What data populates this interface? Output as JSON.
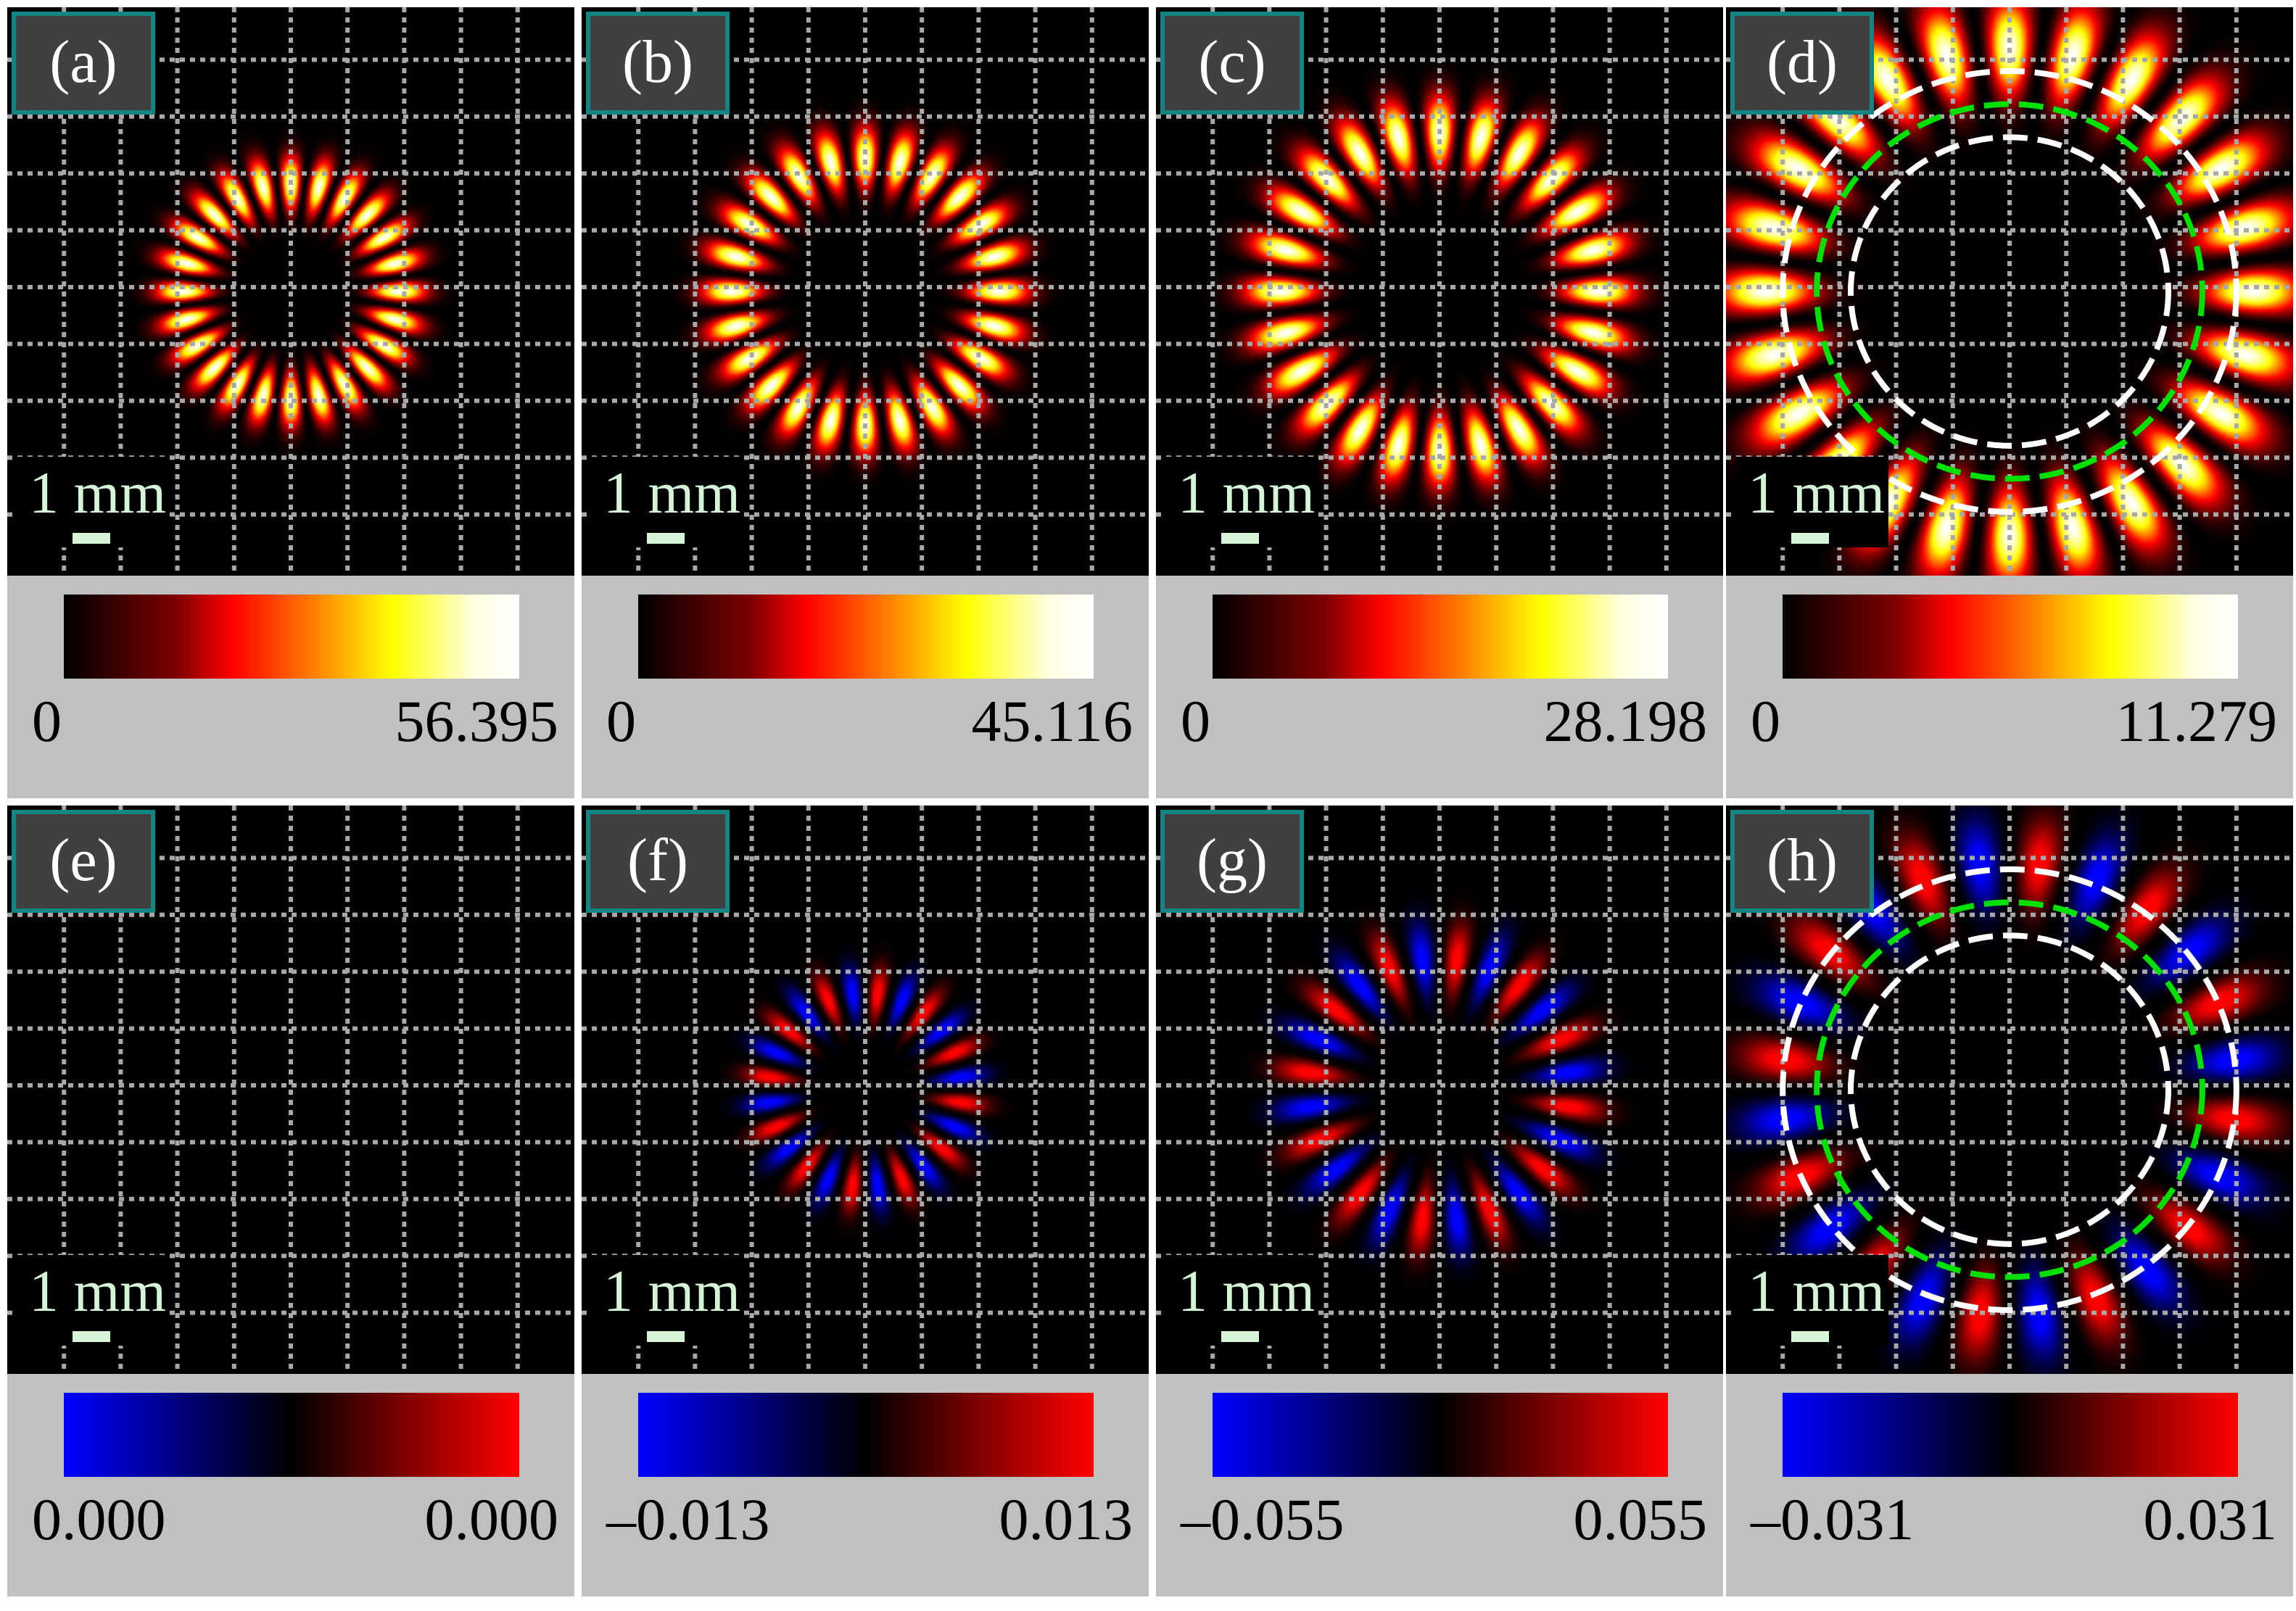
{
  "figure": {
    "scale_bar_label": "1 mm",
    "colors": {
      "background": "#ffffff",
      "colorbar_panel": "#c0c0c0",
      "tag_border": "#148585",
      "tag_fill": "#404040",
      "scale_text": "#d6f5d6",
      "grid": "#a8a8a8",
      "guide_outer": "#ffffff",
      "guide_mid": "#00e000"
    }
  },
  "chart_data": {
    "type": "heatmap",
    "title": "",
    "grid": true,
    "panels": [
      {
        "label": "(a)",
        "colormap": "hot",
        "vmin": 0,
        "vmax": 56.395,
        "min_label": "0",
        "max_label": "56.395",
        "pattern": "ring",
        "lobes": 24,
        "ring_radius": 0.19,
        "ring_width": 0.045,
        "guide_circles": false
      },
      {
        "label": "(b)",
        "colormap": "hot",
        "vmin": 0,
        "vmax": 45.116,
        "min_label": "0",
        "max_label": "45.116",
        "pattern": "ring",
        "lobes": 24,
        "ring_radius": 0.235,
        "ring_width": 0.05,
        "guide_circles": false
      },
      {
        "label": "(c)",
        "colormap": "hot",
        "vmin": 0,
        "vmax": 28.198,
        "min_label": "0",
        "max_label": "28.198",
        "pattern": "ring",
        "lobes": 24,
        "ring_radius": 0.28,
        "ring_width": 0.06,
        "guide_circles": false
      },
      {
        "label": "(d)",
        "colormap": "hot",
        "vmin": 0,
        "vmax": 11.279,
        "min_label": "0",
        "max_label": "11.279",
        "pattern": "ring",
        "lobes": 24,
        "ring_radius": 0.43,
        "ring_width": 0.08,
        "guide_circles": true
      },
      {
        "label": "(e)",
        "colormap": "bwr-dark",
        "vmin": 0.0,
        "vmax": 0.0,
        "min_label": "0.000",
        "max_label": "0.000",
        "pattern": "none",
        "lobes": 24,
        "ring_radius": 0,
        "ring_width": 0,
        "guide_circles": false
      },
      {
        "label": "(f)",
        "colormap": "bwr-dark",
        "vmin": -0.013,
        "vmax": 0.013,
        "min_label": "–0.013",
        "max_label": "0.013",
        "pattern": "signed-ring",
        "lobes": 24,
        "ring_radius": 0.17,
        "ring_width": 0.045,
        "guide_circles": false
      },
      {
        "label": "(g)",
        "colormap": "bwr-dark",
        "vmin": -0.055,
        "vmax": 0.055,
        "min_label": "–0.055",
        "max_label": "0.055",
        "pattern": "signed-ring",
        "lobes": 24,
        "ring_radius": 0.23,
        "ring_width": 0.06,
        "guide_circles": false
      },
      {
        "label": "(h)",
        "colormap": "bwr-dark",
        "vmin": -0.031,
        "vmax": 0.031,
        "min_label": "–0.031",
        "max_label": "0.031",
        "pattern": "signed-ring",
        "lobes": 24,
        "ring_radius": 0.4,
        "ring_width": 0.075,
        "guide_circles": true
      }
    ]
  }
}
